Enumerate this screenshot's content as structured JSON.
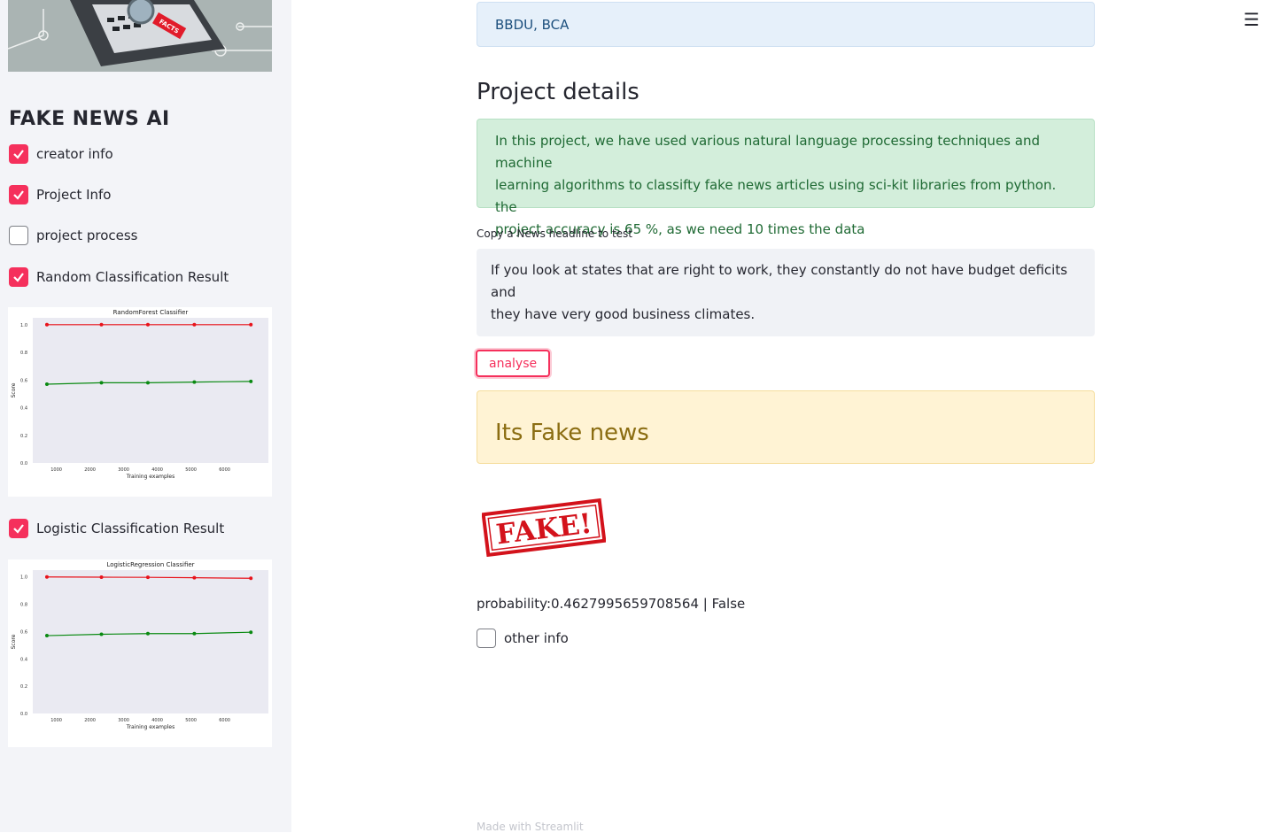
{
  "sidebar": {
    "title": "FAKE NEWS AI",
    "hero_text": "FACTS",
    "checkboxes": [
      {
        "label": "creator info",
        "checked": true
      },
      {
        "label": "Project Info",
        "checked": true
      },
      {
        "label": "project process",
        "checked": false
      },
      {
        "label": "Random Classification Result",
        "checked": true
      },
      {
        "label": "Logistic Classification Result",
        "checked": true
      }
    ],
    "accent_color": "#f5305c"
  },
  "plots": [
    {
      "title": "RandomForest Classifier",
      "xlabel": "Training examples",
      "ylabel": "Score",
      "x_ticks": [
        "1000",
        "2000",
        "3000",
        "4000",
        "5000",
        "6000"
      ],
      "y_ticks": [
        "0.0",
        "0.2",
        "0.4",
        "0.6",
        "0.8",
        "1.0"
      ]
    },
    {
      "title": "LogisticRegression Classifier",
      "xlabel": "Training examples",
      "ylabel": "Score",
      "x_ticks": [
        "1000",
        "2000",
        "3000",
        "4000",
        "5000",
        "6000"
      ],
      "y_ticks": [
        "0.0",
        "0.2",
        "0.4",
        "0.6",
        "0.8",
        "1.0"
      ]
    }
  ],
  "chart_data": [
    {
      "type": "line",
      "title": "RandomForest Classifier",
      "xlabel": "Training examples",
      "ylabel": "Score",
      "ylim": [
        0,
        1.05
      ],
      "xlim": [
        300,
        7300
      ],
      "series": [
        {
          "color": "#e8131b",
          "x": [
            720,
            2340,
            3720,
            5100,
            6780
          ],
          "values": [
            1.0,
            1.0,
            1.0,
            1.0,
            1.0
          ]
        },
        {
          "color": "#0a8a12",
          "x": [
            720,
            2340,
            3720,
            5100,
            6780
          ],
          "values": [
            0.57,
            0.58,
            0.58,
            0.585,
            0.59
          ]
        }
      ]
    },
    {
      "type": "line",
      "title": "LogisticRegression Classifier",
      "xlabel": "Training examples",
      "ylabel": "Score",
      "ylim": [
        0,
        1.05
      ],
      "xlim": [
        300,
        7300
      ],
      "series": [
        {
          "color": "#e8131b",
          "x": [
            720,
            2340,
            3720,
            5100,
            6780
          ],
          "values": [
            1.0,
            0.998,
            0.997,
            0.994,
            0.99
          ]
        },
        {
          "color": "#0a8a12",
          "x": [
            720,
            2340,
            3720,
            5100,
            6780
          ],
          "values": [
            0.57,
            0.58,
            0.585,
            0.585,
            0.595
          ]
        }
      ]
    }
  ],
  "main": {
    "info_text": "BBDU, BCA",
    "heading": "Project details",
    "success_lines": [
      "In this project, we have used various natural language processing techniques and machine",
      "learning algorithms to classifty fake news articles using sci-kit libraries from python. the",
      "project accuracy is 65 %, as we need 10 times the data"
    ],
    "input_label": "Copy a News headline to test",
    "input_lines": [
      "If you look at states that are right to work, they constantly do not have budget deficits and",
      "they have very good business climates."
    ],
    "button_label": "analyse",
    "result": "Its Fake news",
    "stamp_text": "FAKE!",
    "probability": "probability:0.4627995659708564 | False",
    "other_checkbox": {
      "label": "other info",
      "checked": false
    },
    "footer": "Made with Streamlit",
    "menu_icon": "hamburger-menu-icon"
  }
}
